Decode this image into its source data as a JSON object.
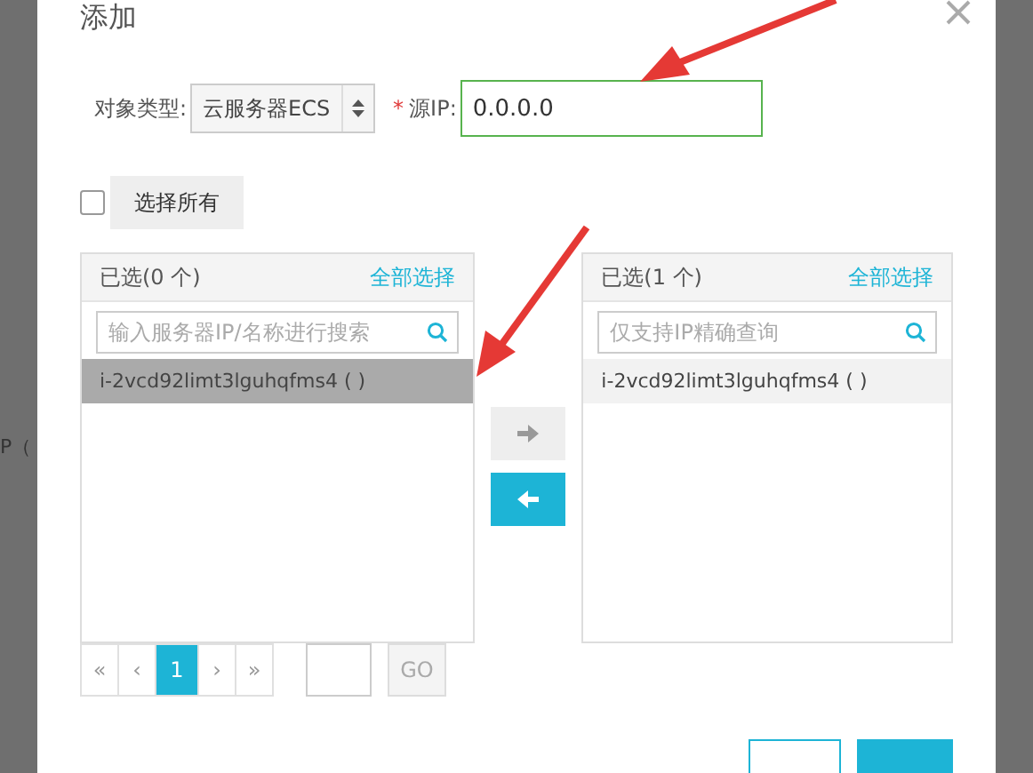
{
  "background_text": "P（",
  "dialog": {
    "title": "添加",
    "filter": {
      "type_label": "对象类型:",
      "type_value": "云服务器ECS",
      "required_mark": "*",
      "ip_label": "源IP:",
      "ip_value": "0.0.0.0"
    },
    "select_all": {
      "checked": false,
      "label": "选择所有"
    },
    "source_panel": {
      "title": "已选(0 个)",
      "action": "全部选择",
      "placeholder": "输入服务器IP/名称进行搜索",
      "items": [
        {
          "label": "i-2vcd92limt3lguhqfms4 ( )",
          "selected": true
        }
      ]
    },
    "pagination": {
      "first": "«",
      "prev": "‹",
      "pages": [
        {
          "label": "1",
          "selected": true
        }
      ],
      "next": "›",
      "last": "»",
      "go": "GO"
    },
    "transfer": [
      {
        "kind": "right",
        "disabled": true
      },
      {
        "kind": "left",
        "disabled": false
      }
    ],
    "target_panel": {
      "title": "已选(1 个)",
      "action": "全部选择",
      "placeholder": "仅支持IP精确查询",
      "items": [
        {
          "label": "i-2vcd92limt3lguhqfms4 ( )",
          "selected": false
        }
      ]
    },
    "footer_buttons": [
      {
        "kind": "outline"
      },
      {
        "kind": "primary"
      }
    ]
  }
}
